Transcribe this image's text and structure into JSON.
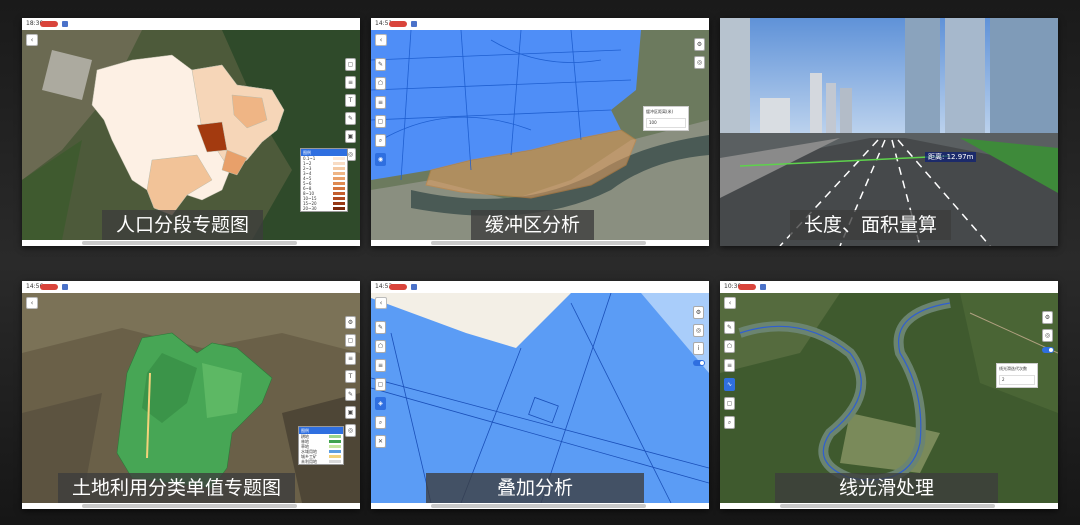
{
  "panels": [
    {
      "id": "population",
      "status": {
        "time": "18:30"
      },
      "caption": "人口分段专题图",
      "legend": {
        "title": "图例",
        "rows": [
          "0.1~1",
          "1~2",
          "2~3",
          "3~4",
          "4~5",
          "5~6",
          "6~8",
          "8~10",
          "10~15",
          "15~20",
          "20~30"
        ],
        "colors": [
          "#fbe9dc",
          "#f8dcc4",
          "#f4caa5",
          "#efb585",
          "#e8a06a",
          "#df8a51",
          "#d3743d",
          "#c45e2e",
          "#b04a22",
          "#973815",
          "#7a280c"
        ]
      }
    },
    {
      "id": "buffer",
      "status": {
        "time": "14:51"
      },
      "caption": "缓冲区分析",
      "infobox": {
        "title": "缓冲区距离(米)",
        "value": "100"
      }
    },
    {
      "id": "measure",
      "caption": "长度、面积量算",
      "distance_label": "距离: 12.97m"
    },
    {
      "id": "landuse",
      "status": {
        "time": "14:56"
      },
      "caption": "土地利用分类单值专题图",
      "legend": {
        "title": "图例",
        "rows": [
          "耕地",
          "林地",
          "草地",
          "水域用地",
          "城乡工矿",
          "未利用地"
        ],
        "colors": [
          "#9bd48c",
          "#3fa34d",
          "#c5e6a0",
          "#5c9de0",
          "#f3d27a",
          "#d9d9d9"
        ]
      }
    },
    {
      "id": "overlay",
      "status": {
        "time": "14:53"
      },
      "caption": "叠加分析"
    },
    {
      "id": "smooth",
      "status": {
        "time": "10:30"
      },
      "caption": "线光滑处理",
      "infobox": {
        "title": "线光滑迭代次数",
        "value": "2"
      }
    }
  ],
  "colors": {
    "accent_blue": "#2f6fe0",
    "buffer_fill": "#4f8ef7",
    "buffer_ring": "#e6a060",
    "caption_bg": "#3c3c3c",
    "statusbar_badge": "#d9443b"
  },
  "icons": [
    "back-icon",
    "select-tool-icon",
    "layer-icon",
    "measure-icon",
    "toggle-icon"
  ]
}
